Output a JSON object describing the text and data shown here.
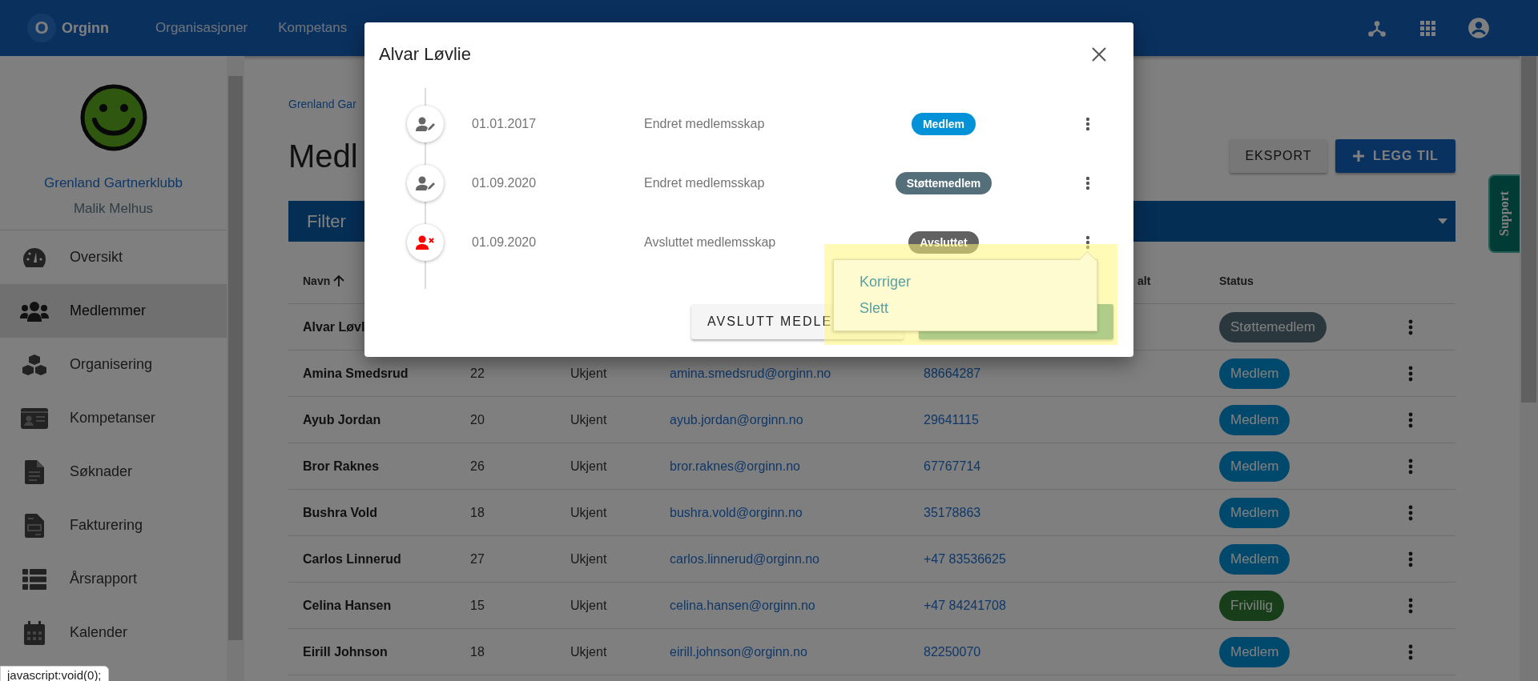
{
  "topbar": {
    "logo_letter": "O",
    "brand": "Orginn",
    "nav": [
      "Organisasjoner",
      "Kompetans"
    ]
  },
  "sidebar": {
    "org_name": "Grenland Gartnerklubb",
    "user_name": "Malik Melhus",
    "items": [
      {
        "label": "Oversikt",
        "kind": "dashboard",
        "selected": false
      },
      {
        "label": "Medlemmer",
        "kind": "group",
        "selected": true
      },
      {
        "label": "Organisering",
        "kind": "cubes",
        "selected": false
      },
      {
        "label": "Kompetanser",
        "kind": "idcard",
        "selected": false
      },
      {
        "label": "Søknader",
        "kind": "document",
        "selected": false
      },
      {
        "label": "Fakturering",
        "kind": "invoice",
        "selected": false
      },
      {
        "label": "Årsrapport",
        "kind": "list",
        "selected": false
      },
      {
        "label": "Kalender",
        "kind": "calendar",
        "selected": false
      }
    ]
  },
  "main": {
    "breadcrumb": "Grenland Gar",
    "heading": "Medl",
    "buttons": [
      {
        "label": "EKSPORT",
        "kind": "plain"
      },
      {
        "label": "LEGG TIL",
        "kind": "primary"
      }
    ],
    "filter": {
      "label": "Filter"
    },
    "table": {
      "header": {
        "name": "Navn",
        "sorted_ascending": true,
        "column_6": "alt",
        "status": "Status"
      },
      "rows": [
        {
          "name": "Alvar Løvl",
          "status": {
            "label": "Støttemedlem",
            "kind": "support"
          }
        },
        {
          "name": "Amina Smedsrud",
          "age": "22",
          "gender": "Ukjent",
          "email": "amina.smedsrud@orginn.no",
          "phone": "88664287",
          "status": {
            "label": "Medlem",
            "kind": "member"
          }
        },
        {
          "name": "Ayub Jordan",
          "age": "20",
          "gender": "Ukjent",
          "email": "ayub.jordan@orginn.no",
          "phone": "29641115",
          "status": {
            "label": "Medlem",
            "kind": "member"
          }
        },
        {
          "name": "Bror Raknes",
          "age": "26",
          "gender": "Ukjent",
          "email": "bror.raknes@orginn.no",
          "phone": "67767714",
          "status": {
            "label": "Medlem",
            "kind": "member"
          }
        },
        {
          "name": "Bushra Vold",
          "age": "18",
          "gender": "Ukjent",
          "email": "bushra.vold@orginn.no",
          "phone": "35178863",
          "status": {
            "label": "Medlem",
            "kind": "member"
          }
        },
        {
          "name": "Carlos Linnerud",
          "age": "27",
          "gender": "Ukjent",
          "email": "carlos.linnerud@orginn.no",
          "phone": "+47 83536625",
          "status": {
            "label": "Medlem",
            "kind": "member"
          }
        },
        {
          "name": "Celina Hansen",
          "age": "15",
          "gender": "Ukjent",
          "email": "celina.hansen@orginn.no",
          "phone": "+47 84241708",
          "status": {
            "label": "Frivillig",
            "kind": "volunteer"
          }
        },
        {
          "name": "Eirill Johnson",
          "age": "18",
          "gender": "Ukjent",
          "email": "eirill.johnson@orginn.no",
          "phone": "82250070",
          "status": {
            "label": "Medlem",
            "kind": "member"
          }
        }
      ]
    }
  },
  "support_tab": {
    "label": "Support"
  },
  "modal": {
    "title": "Alvar Løvlie",
    "events": [
      {
        "kind": "changed",
        "date": "01.01.2017",
        "text": "Endret medlemsskap",
        "badge": {
          "label": "Medlem",
          "kind": "member"
        }
      },
      {
        "kind": "changed",
        "date": "01.09.2020",
        "text": "Endret medlemsskap",
        "badge": {
          "label": "Støttemedlem",
          "kind": "support"
        }
      },
      {
        "kind": "ended",
        "date": "01.09.2020",
        "text": "Avsluttet medlemsskap",
        "badge": {
          "label": "Avsluttet",
          "kind": "ended"
        }
      }
    ],
    "buttons": [
      {
        "label": "AVSLUTT MEDLE",
        "kind": "raised"
      },
      {
        "kind": "primary"
      }
    ],
    "menu": {
      "items": [
        "Korriger",
        "Slett"
      ]
    }
  },
  "status_url": "javascript:void(0);"
}
